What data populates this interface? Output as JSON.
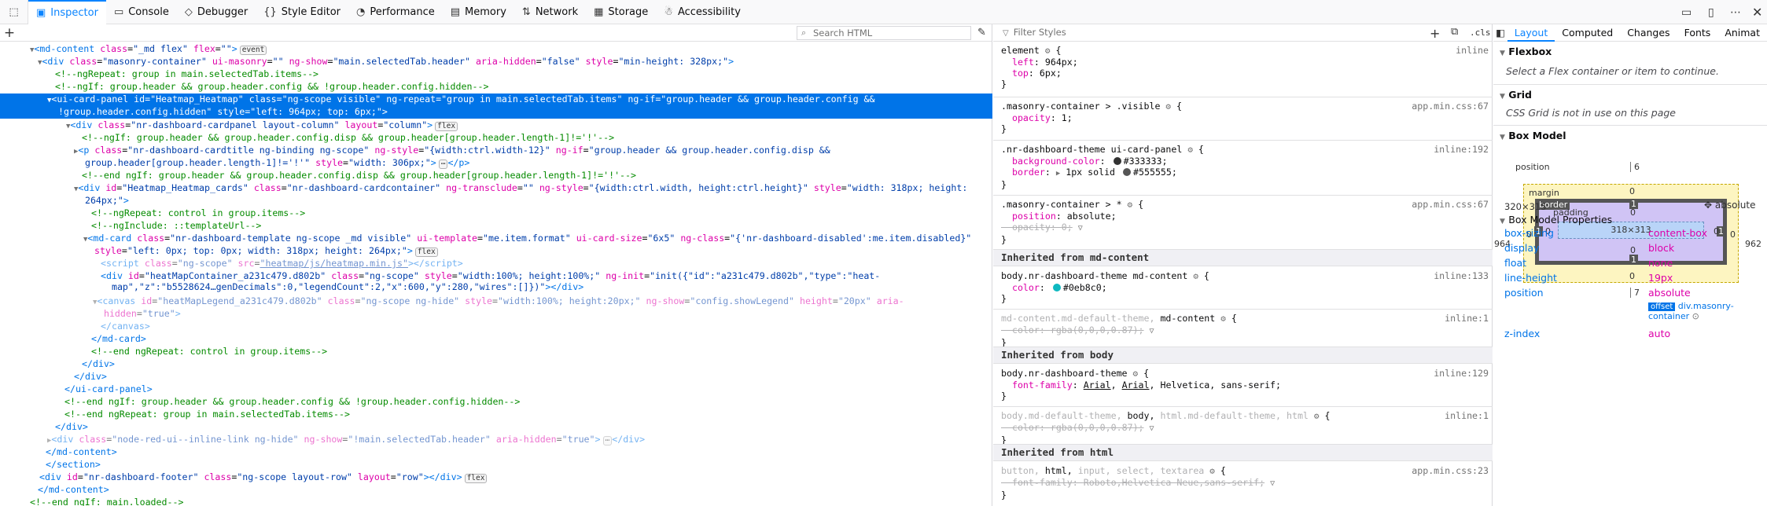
{
  "toolbar": {
    "tabs": [
      {
        "label": "Inspector",
        "icon": "inspector-icon"
      },
      {
        "label": "Console",
        "icon": "console-icon"
      },
      {
        "label": "Debugger",
        "icon": "debugger-icon"
      },
      {
        "label": "Style Editor",
        "icon": "style-editor-icon"
      },
      {
        "label": "Performance",
        "icon": "performance-icon"
      },
      {
        "label": "Memory",
        "icon": "memory-icon"
      },
      {
        "label": "Network",
        "icon": "network-icon"
      },
      {
        "label": "Storage",
        "icon": "storage-icon"
      },
      {
        "label": "Accessibility",
        "icon": "accessibility-icon"
      }
    ]
  },
  "markup": {
    "search_placeholder": "Search HTML",
    "add_label": "+"
  },
  "rules": {
    "filter_placeholder": "Filter Styles",
    "cls_label": ".cls",
    "plus_label": "+",
    "inherited": [
      "Inherited from md-content",
      "Inherited from body",
      "Inherited from html"
    ]
  },
  "layout": {
    "tabs": [
      "Layout",
      "Computed",
      "Changes",
      "Fonts",
      "Animat"
    ],
    "flexbox_title": "Flexbox",
    "flexbox_msg": "Select a Flex container or item to continue.",
    "grid_title": "Grid",
    "grid_msg": "CSS Grid is not in use on this page",
    "boxmodel_title": "Box Model",
    "bm": {
      "position_label": "position",
      "position_top": "6",
      "position_left": "964",
      "position_right": "962",
      "position_bottom": "7",
      "margin_label": "margin",
      "margin_top": "0",
      "margin_bottom": "0",
      "margin_left": "0",
      "margin_right": "0",
      "border_label": "border",
      "border_top": "1",
      "border_bottom": "1",
      "border_left": "1",
      "border_right": "1",
      "padding_label": "padding",
      "padding_top": "0",
      "padding_bottom": "0",
      "padding_left": "0",
      "padding_right": "0",
      "content": "318×313"
    },
    "size": "320×315",
    "position_value": "absolute",
    "props_title": "Box Model Properties",
    "props": [
      {
        "name": "box-sizing",
        "value": "content-box"
      },
      {
        "name": "display",
        "value": "block"
      },
      {
        "name": "float",
        "value": "none"
      },
      {
        "name": "line-height",
        "value": "19px"
      },
      {
        "name": "position",
        "value": "absolute"
      },
      {
        "name": "z-index",
        "value": "auto"
      }
    ],
    "offset_badge": "offset",
    "offset_target": "div.masonry-container"
  }
}
